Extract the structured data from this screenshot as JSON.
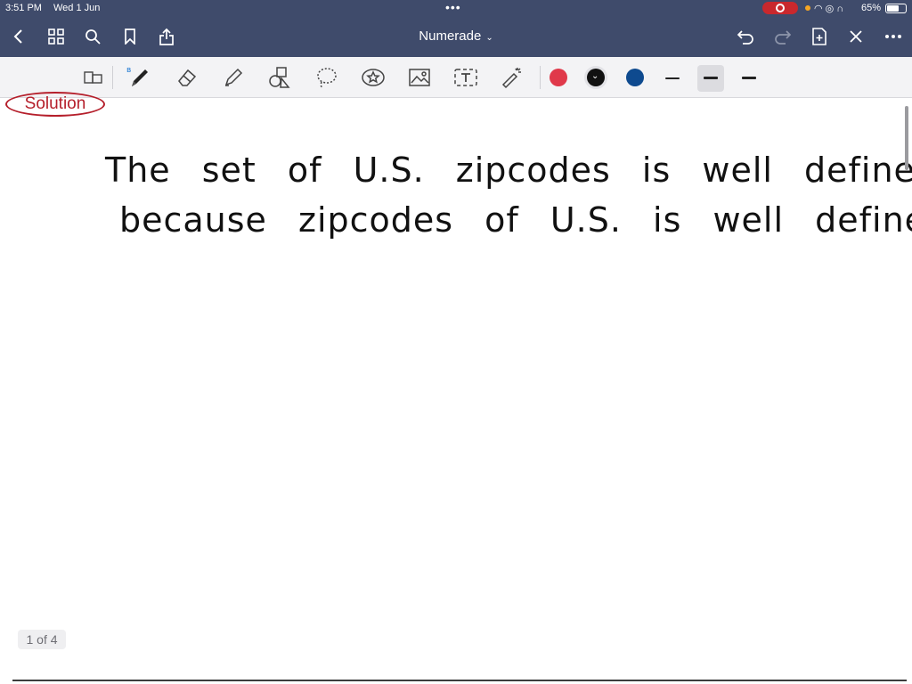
{
  "status_bar": {
    "time": "3:51 PM",
    "date": "Wed 1 Jun",
    "battery": "65%"
  },
  "nav": {
    "title": "Numerade",
    "icons": [
      "back-icon",
      "grid-icon",
      "search-icon",
      "bookmark-icon",
      "share-icon",
      "undo-icon",
      "redo-icon",
      "add-page-icon",
      "close-icon",
      "more-icon"
    ]
  },
  "toolbar": {
    "tools": [
      "reader-icon",
      "pen-icon",
      "eraser-icon",
      "highlighter-icon",
      "shapes-icon",
      "lasso-icon",
      "sticker-icon",
      "image-icon",
      "text-icon",
      "laser-icon"
    ],
    "colors": [
      "#e0394a",
      "#111111",
      "#0e4a8f"
    ],
    "selected_color": "#111111",
    "stroke_widths": [
      "thin",
      "medium",
      "thick"
    ],
    "selected_stroke": "medium"
  },
  "page": {
    "badge": "Solution",
    "lines": [
      "The set of U.S. zipcodes is well defined",
      "because zipcodes of U.S. is well defined"
    ],
    "page_indicator": "1 of 4"
  }
}
